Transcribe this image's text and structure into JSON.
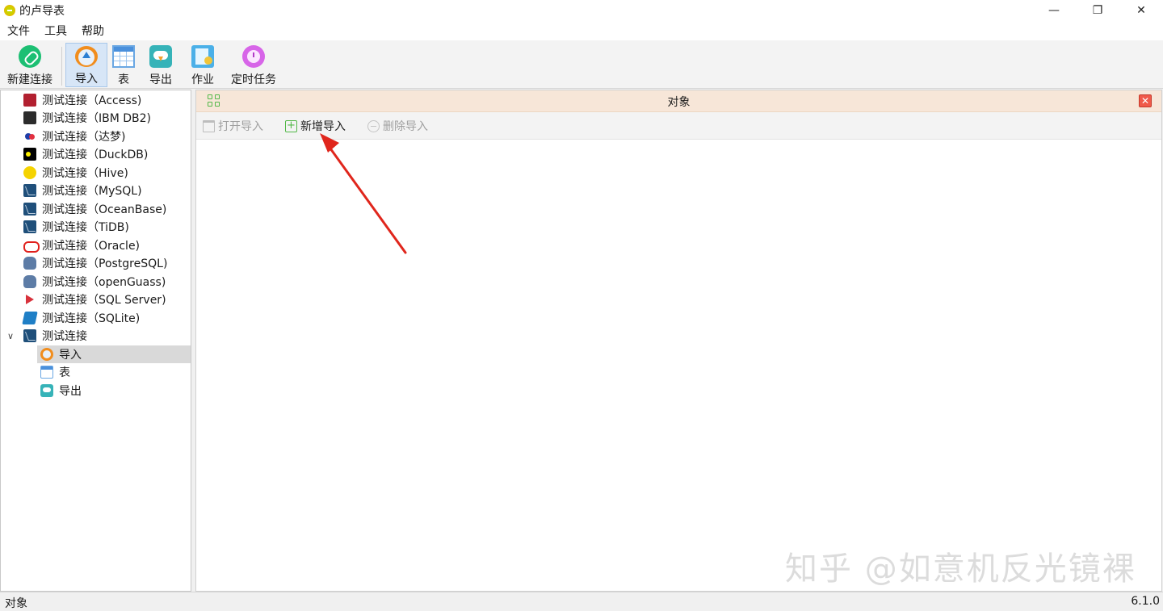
{
  "window": {
    "title": "的卢导表",
    "controls": [
      "—",
      "❐",
      "✕"
    ]
  },
  "menu": {
    "items": [
      "文件",
      "工具",
      "帮助"
    ]
  },
  "toolbar": {
    "new_connection": "新建连接",
    "import": "导入",
    "table": "表",
    "export": "导出",
    "job": "作业",
    "scheduled_task": "定时任务"
  },
  "sidebar": {
    "connections": [
      {
        "label": "测试连接（Access)",
        "icon": "access-icon"
      },
      {
        "label": "测试连接（IBM DB2)",
        "icon": "db2-icon"
      },
      {
        "label": "测试连接（达梦)",
        "icon": "dameng-icon"
      },
      {
        "label": "测试连接（DuckDB)",
        "icon": "duckdb-icon"
      },
      {
        "label": "测试连接（Hive)",
        "icon": "hive-icon"
      },
      {
        "label": "测试连接（MySQL)",
        "icon": "mysql-icon"
      },
      {
        "label": "测试连接（OceanBase)",
        "icon": "oceanbase-icon"
      },
      {
        "label": "测试连接（TiDB)",
        "icon": "tidb-icon"
      },
      {
        "label": "测试连接（Oracle)",
        "icon": "oracle-icon"
      },
      {
        "label": "测试连接（PostgreSQL)",
        "icon": "postgresql-icon"
      },
      {
        "label": "测试连接（openGuass)",
        "icon": "opengauss-icon"
      },
      {
        "label": "测试连接（SQL Server)",
        "icon": "sqlserver-icon"
      },
      {
        "label": "测试连接（SQLite)",
        "icon": "sqlite-icon"
      }
    ],
    "expanded": {
      "label": "测试连接",
      "children": [
        {
          "label": "导入",
          "selected": true
        },
        {
          "label": "表"
        },
        {
          "label": "导出"
        }
      ]
    }
  },
  "panel": {
    "title": "对象",
    "tools": {
      "open_import": "打开导入",
      "new_import": "新增导入",
      "delete_import": "删除导入"
    }
  },
  "watermark": "知乎 @如意机反光镜裸",
  "status": {
    "left": "对象",
    "version": "6.1.0"
  },
  "colors": {
    "accent_green": "#52b848",
    "header_bg": "#f7e6d8",
    "arrow_red": "#e0261c",
    "selected_bg": "#d9d9d9"
  }
}
